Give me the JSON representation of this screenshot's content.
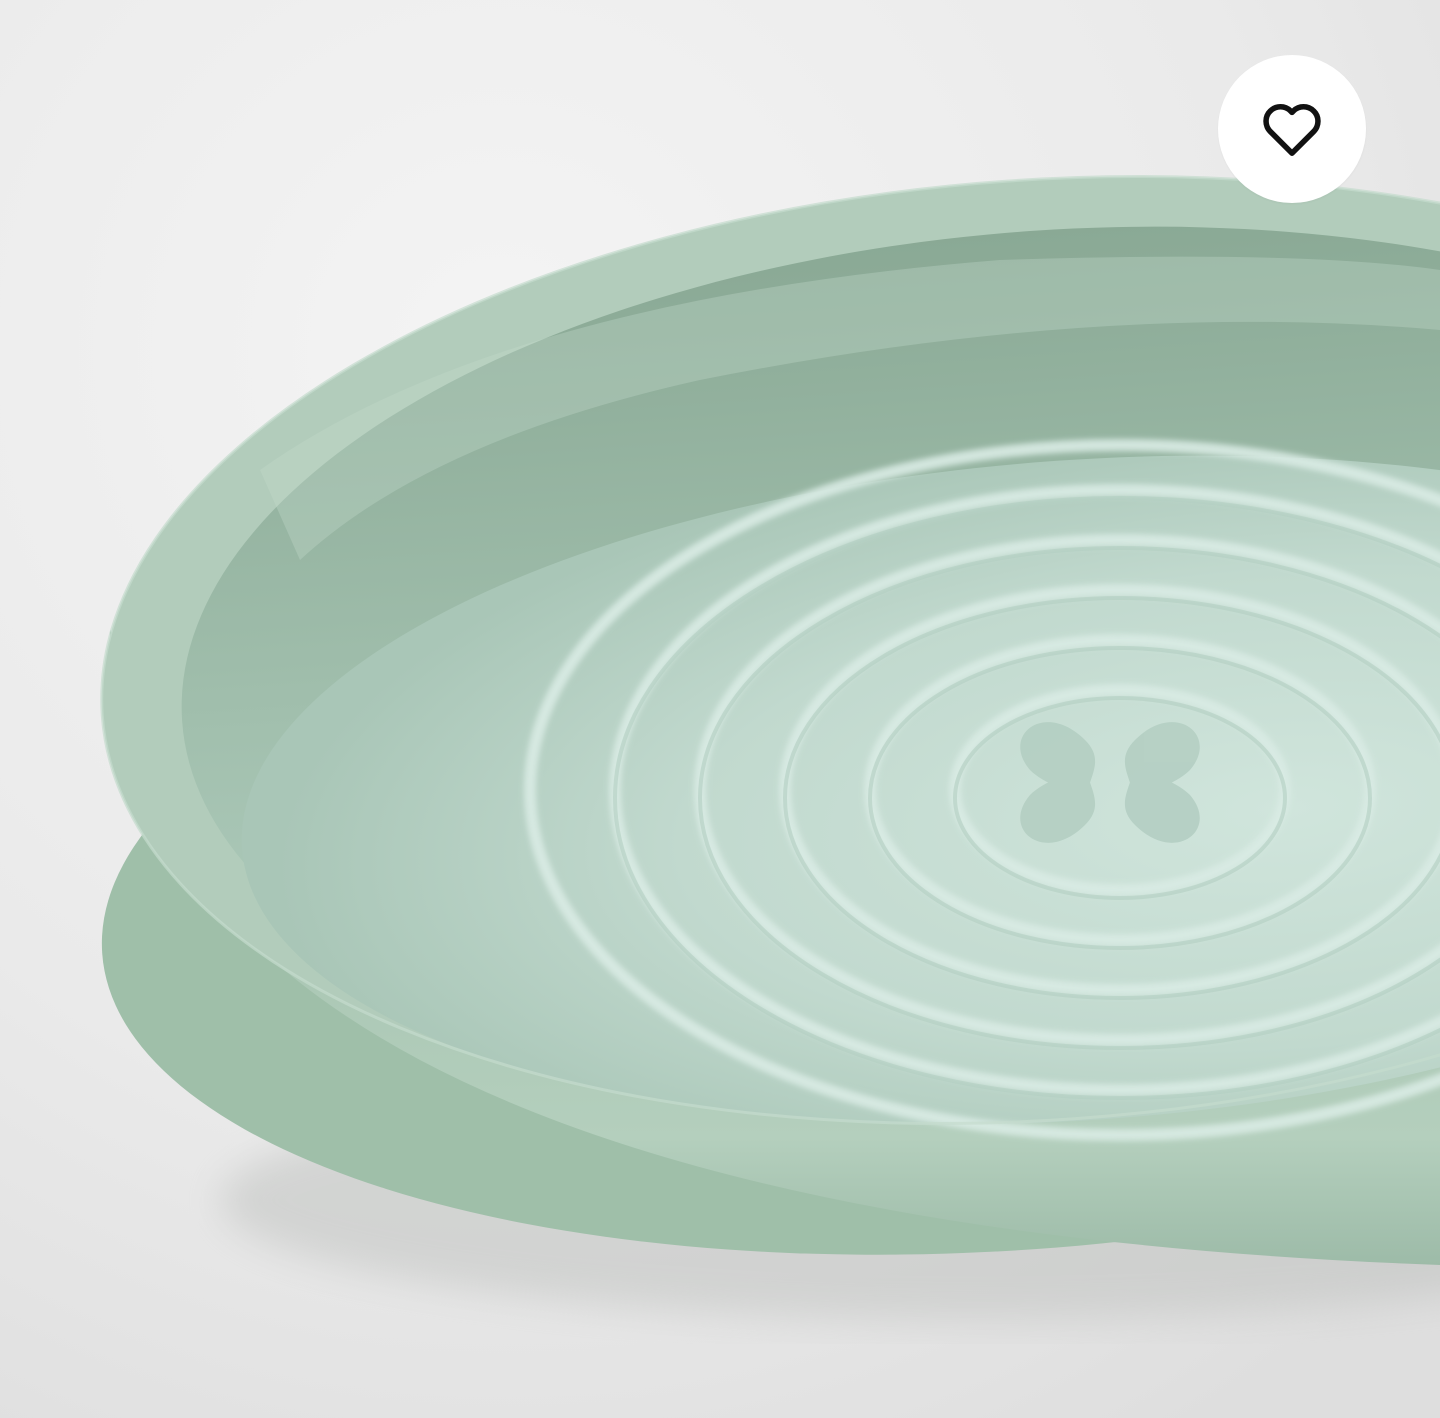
{
  "product_image": {
    "subject": "plate-photo",
    "colors": {
      "background": "#ebebeb",
      "plate_outer": "#a9c5b2",
      "plate_inner": "#c4dcd2",
      "plate_shadow": "#7e9c88",
      "ring": "#d6e8e1"
    }
  },
  "favorite_button": {
    "icon": "heart-outline-icon",
    "colors": {
      "background": "#ffffff",
      "icon": "#111111"
    }
  }
}
